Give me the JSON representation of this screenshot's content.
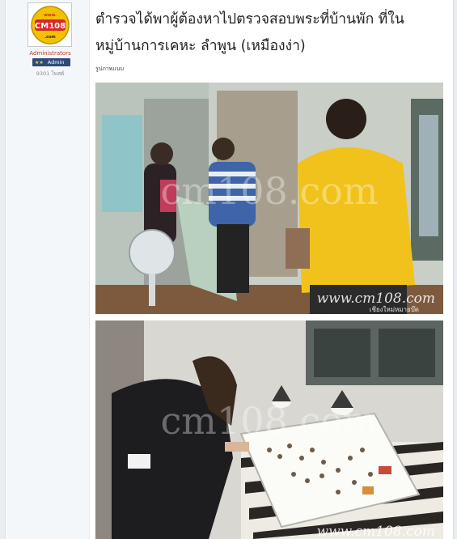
{
  "post": {
    "title": "ตำรวจได้พาผู้ต้องหาไปตรวจสอบพระที่บ้านพัก ที่ในหมู่บ้านการเคหะ ลำพูน (เหมืองง่า)",
    "subtitle": "รูปภาพแนบ"
  },
  "author": {
    "avatar_logo": "CM108",
    "avatar_top": "www.",
    "avatar_bottom": ".com",
    "username": "Administrators",
    "rank_badge": "Admin",
    "rank_stars": "★★",
    "post_count": "9301 โพสต์"
  },
  "photos": [
    {
      "name": "photo-suspect-room",
      "watermark_center": "cm108.com",
      "watermark_url": "www.cm108.com",
      "watermark_caption": "เชียงใหม่หมายบ๊ด"
    },
    {
      "name": "photo-amulet-table",
      "watermark_center": "cm108.com",
      "watermark_url": "www.cm108.com"
    }
  ],
  "colors": {
    "username": "#c0392b",
    "rank_badge_bg": "#2d4b7a",
    "avatar_yellow": "#f2c200",
    "avatar_red": "#d62828"
  }
}
